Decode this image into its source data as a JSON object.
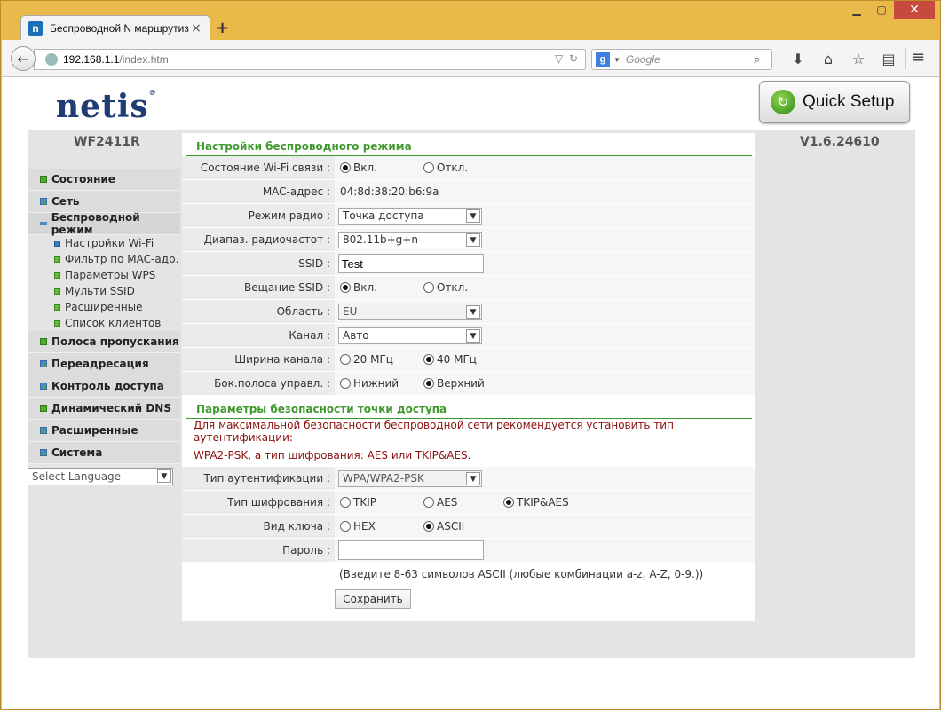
{
  "browser": {
    "tab_title": "Беспроводной N маршрутиз...",
    "tab_favicon_letter": "n",
    "url_host": "192.168.1.1",
    "url_path": "/index.htm",
    "search_placeholder": "Google",
    "search_engine_letter": "g"
  },
  "header": {
    "logo_text": "netis",
    "logo_mark": "®",
    "quick_setup_label": "Quick Setup",
    "model": "WF2411R",
    "firmware": "V1.6.24610"
  },
  "sidebar": {
    "items": [
      {
        "label": "Состояние",
        "bullet": "green"
      },
      {
        "label": "Сеть",
        "bullet": "grid"
      },
      {
        "label": "Беспроводной режим",
        "bullet": "minus"
      }
    ],
    "subitems": [
      {
        "label": "Настройки Wi-Fi",
        "bullet": "blue"
      },
      {
        "label": "Фильтр по MAC-адр.",
        "bullet": "green"
      },
      {
        "label": "Параметры WPS",
        "bullet": "green"
      },
      {
        "label": "Мульти SSID",
        "bullet": "green"
      },
      {
        "label": "Расширенные",
        "bullet": "green"
      },
      {
        "label": "Список клиентов",
        "bullet": "green"
      }
    ],
    "items_after": [
      {
        "label": "Полоса пропускания",
        "bullet": "green"
      },
      {
        "label": "Переадресация",
        "bullet": "grid"
      },
      {
        "label": "Контроль доступа",
        "bullet": "grid"
      },
      {
        "label": "Динамический DNS",
        "bullet": "green"
      },
      {
        "label": "Расширенные",
        "bullet": "grid"
      },
      {
        "label": "Система",
        "bullet": "grid"
      }
    ],
    "language_select": "Select Language"
  },
  "wireless": {
    "section_title": "Настройки беспроводного режима",
    "wifi_state_label": "Состояние Wi-Fi связи :",
    "on_label": "Вкл.",
    "off_label": "Откл.",
    "mac_label": "MAC-адрес :",
    "mac_value": "04:8d:38:20:b6:9a",
    "radio_mode_label": "Режим радио :",
    "radio_mode_value": "Точка доступа",
    "band_label": "Диапаз. радиочастот :",
    "band_value": "802.11b+g+n",
    "ssid_label": "SSID :",
    "ssid_value": "Test",
    "broadcast_label": "Вещание SSID :",
    "region_label": "Область :",
    "region_value": "EU",
    "channel_label": "Канал :",
    "channel_value": "Авто",
    "width_label": "Ширина канала :",
    "width_20": "20 МГц",
    "width_40": "40 МГц",
    "sideband_label": "Бок.полоса управл. :",
    "sideband_lower": "Нижний",
    "sideband_upper": "Верхний"
  },
  "security": {
    "section_title": "Параметры безопасности точки доступа",
    "warning_line1": "Для максимальной безопасности беспроводной сети рекомендуется установить тип аутентификации:",
    "warning_line2": "WPA2-PSK, а тип шифрования: AES или TKIP&AES.",
    "auth_label": "Тип аутентификации :",
    "auth_value": "WPA/WPA2-PSK",
    "cipher_label": "Тип шифрования :",
    "cipher_tkip": "TKIP",
    "cipher_aes": "AES",
    "cipher_both": "TKIP&AES",
    "key_type_label": "Вид ключа :",
    "key_hex": "HEX",
    "key_ascii": "ASCII",
    "password_label": "Пароль :",
    "password_value": "",
    "hint": "(Введите 8-63 символов ASCII (любые комбинации a-z, A-Z, 0-9.))",
    "save_label": "Сохранить"
  },
  "colors": {
    "section_green": "#3f9a2e",
    "warning_red": "#8b1010",
    "logo_blue": "#1f3c74",
    "window_frame": "#e9b949"
  }
}
